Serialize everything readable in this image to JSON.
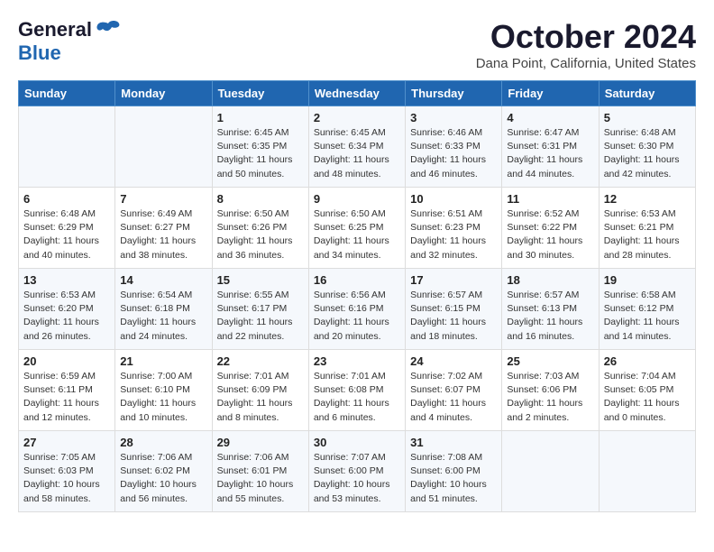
{
  "logo": {
    "general": "General",
    "blue": "Blue"
  },
  "title": "October 2024",
  "location": "Dana Point, California, United States",
  "days_header": [
    "Sunday",
    "Monday",
    "Tuesday",
    "Wednesday",
    "Thursday",
    "Friday",
    "Saturday"
  ],
  "weeks": [
    [
      {
        "day": "",
        "info": ""
      },
      {
        "day": "",
        "info": ""
      },
      {
        "day": "1",
        "info": "Sunrise: 6:45 AM\nSunset: 6:35 PM\nDaylight: 11 hours and 50 minutes."
      },
      {
        "day": "2",
        "info": "Sunrise: 6:45 AM\nSunset: 6:34 PM\nDaylight: 11 hours and 48 minutes."
      },
      {
        "day": "3",
        "info": "Sunrise: 6:46 AM\nSunset: 6:33 PM\nDaylight: 11 hours and 46 minutes."
      },
      {
        "day": "4",
        "info": "Sunrise: 6:47 AM\nSunset: 6:31 PM\nDaylight: 11 hours and 44 minutes."
      },
      {
        "day": "5",
        "info": "Sunrise: 6:48 AM\nSunset: 6:30 PM\nDaylight: 11 hours and 42 minutes."
      }
    ],
    [
      {
        "day": "6",
        "info": "Sunrise: 6:48 AM\nSunset: 6:29 PM\nDaylight: 11 hours and 40 minutes."
      },
      {
        "day": "7",
        "info": "Sunrise: 6:49 AM\nSunset: 6:27 PM\nDaylight: 11 hours and 38 minutes."
      },
      {
        "day": "8",
        "info": "Sunrise: 6:50 AM\nSunset: 6:26 PM\nDaylight: 11 hours and 36 minutes."
      },
      {
        "day": "9",
        "info": "Sunrise: 6:50 AM\nSunset: 6:25 PM\nDaylight: 11 hours and 34 minutes."
      },
      {
        "day": "10",
        "info": "Sunrise: 6:51 AM\nSunset: 6:23 PM\nDaylight: 11 hours and 32 minutes."
      },
      {
        "day": "11",
        "info": "Sunrise: 6:52 AM\nSunset: 6:22 PM\nDaylight: 11 hours and 30 minutes."
      },
      {
        "day": "12",
        "info": "Sunrise: 6:53 AM\nSunset: 6:21 PM\nDaylight: 11 hours and 28 minutes."
      }
    ],
    [
      {
        "day": "13",
        "info": "Sunrise: 6:53 AM\nSunset: 6:20 PM\nDaylight: 11 hours and 26 minutes."
      },
      {
        "day": "14",
        "info": "Sunrise: 6:54 AM\nSunset: 6:18 PM\nDaylight: 11 hours and 24 minutes."
      },
      {
        "day": "15",
        "info": "Sunrise: 6:55 AM\nSunset: 6:17 PM\nDaylight: 11 hours and 22 minutes."
      },
      {
        "day": "16",
        "info": "Sunrise: 6:56 AM\nSunset: 6:16 PM\nDaylight: 11 hours and 20 minutes."
      },
      {
        "day": "17",
        "info": "Sunrise: 6:57 AM\nSunset: 6:15 PM\nDaylight: 11 hours and 18 minutes."
      },
      {
        "day": "18",
        "info": "Sunrise: 6:57 AM\nSunset: 6:13 PM\nDaylight: 11 hours and 16 minutes."
      },
      {
        "day": "19",
        "info": "Sunrise: 6:58 AM\nSunset: 6:12 PM\nDaylight: 11 hours and 14 minutes."
      }
    ],
    [
      {
        "day": "20",
        "info": "Sunrise: 6:59 AM\nSunset: 6:11 PM\nDaylight: 11 hours and 12 minutes."
      },
      {
        "day": "21",
        "info": "Sunrise: 7:00 AM\nSunset: 6:10 PM\nDaylight: 11 hours and 10 minutes."
      },
      {
        "day": "22",
        "info": "Sunrise: 7:01 AM\nSunset: 6:09 PM\nDaylight: 11 hours and 8 minutes."
      },
      {
        "day": "23",
        "info": "Sunrise: 7:01 AM\nSunset: 6:08 PM\nDaylight: 11 hours and 6 minutes."
      },
      {
        "day": "24",
        "info": "Sunrise: 7:02 AM\nSunset: 6:07 PM\nDaylight: 11 hours and 4 minutes."
      },
      {
        "day": "25",
        "info": "Sunrise: 7:03 AM\nSunset: 6:06 PM\nDaylight: 11 hours and 2 minutes."
      },
      {
        "day": "26",
        "info": "Sunrise: 7:04 AM\nSunset: 6:05 PM\nDaylight: 11 hours and 0 minutes."
      }
    ],
    [
      {
        "day": "27",
        "info": "Sunrise: 7:05 AM\nSunset: 6:03 PM\nDaylight: 10 hours and 58 minutes."
      },
      {
        "day": "28",
        "info": "Sunrise: 7:06 AM\nSunset: 6:02 PM\nDaylight: 10 hours and 56 minutes."
      },
      {
        "day": "29",
        "info": "Sunrise: 7:06 AM\nSunset: 6:01 PM\nDaylight: 10 hours and 55 minutes."
      },
      {
        "day": "30",
        "info": "Sunrise: 7:07 AM\nSunset: 6:00 PM\nDaylight: 10 hours and 53 minutes."
      },
      {
        "day": "31",
        "info": "Sunrise: 7:08 AM\nSunset: 6:00 PM\nDaylight: 10 hours and 51 minutes."
      },
      {
        "day": "",
        "info": ""
      },
      {
        "day": "",
        "info": ""
      }
    ]
  ]
}
